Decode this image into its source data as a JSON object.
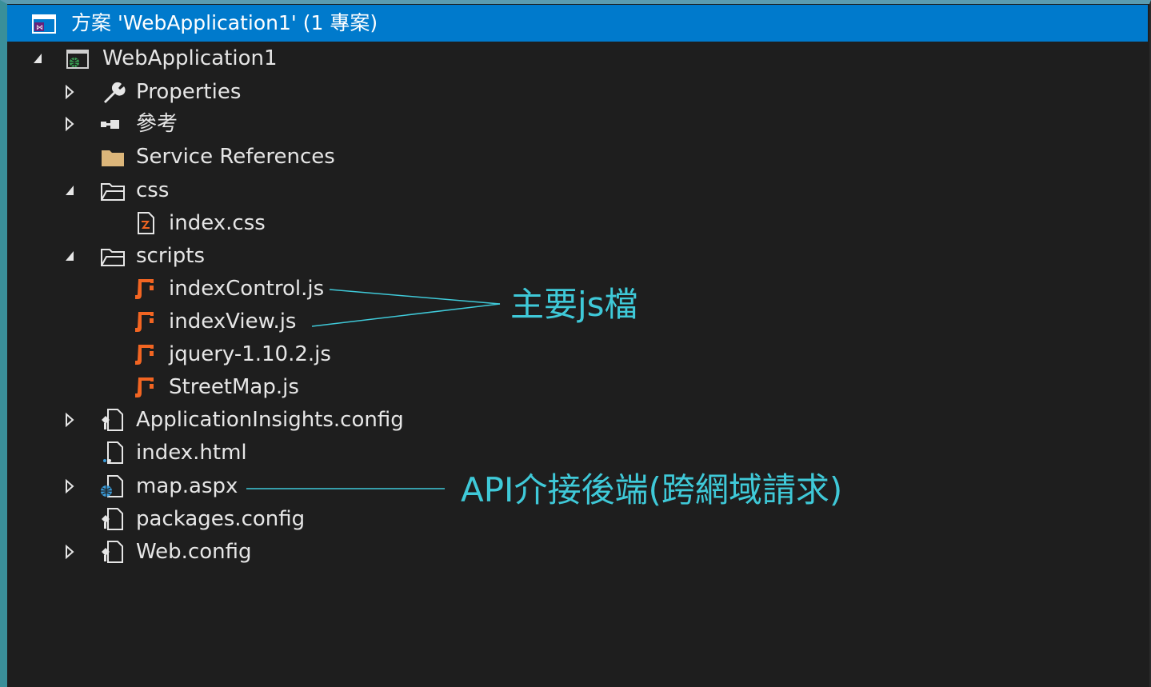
{
  "solution_explorer": {
    "title": "方案 'WebApplication1' (1 專案)",
    "items": [
      {
        "label": "WebApplication1",
        "icon": "web-project-icon",
        "expander": "expanded"
      },
      {
        "label": "Properties",
        "icon": "wrench-icon",
        "expander": "collapsed"
      },
      {
        "label": "參考",
        "icon": "references-icon",
        "expander": "collapsed"
      },
      {
        "label": "Service References",
        "icon": "folder-filled-icon",
        "expander": "none"
      },
      {
        "label": "css",
        "icon": "folder-icon",
        "expander": "expanded"
      },
      {
        "label": "index.css",
        "icon": "css-file-icon",
        "expander": "none"
      },
      {
        "label": "scripts",
        "icon": "folder-icon",
        "expander": "expanded"
      },
      {
        "label": "indexControl.js",
        "icon": "js-file-icon",
        "expander": "none"
      },
      {
        "label": "indexView.js",
        "icon": "js-file-icon",
        "expander": "none"
      },
      {
        "label": "jquery-1.10.2.js",
        "icon": "js-file-icon",
        "expander": "none"
      },
      {
        "label": "StreetMap.js",
        "icon": "js-file-icon",
        "expander": "none"
      },
      {
        "label": "ApplicationInsights.config",
        "icon": "config-file-icon",
        "expander": "collapsed"
      },
      {
        "label": "index.html",
        "icon": "html-file-icon",
        "expander": "none"
      },
      {
        "label": "map.aspx",
        "icon": "aspx-file-icon",
        "expander": "collapsed"
      },
      {
        "label": "packages.config",
        "icon": "config-file-icon",
        "expander": "none"
      },
      {
        "label": "Web.config",
        "icon": "config-file-icon",
        "expander": "collapsed"
      }
    ]
  },
  "annotations": {
    "main_js": "主要js檔",
    "api_backend": "API介接後端(跨網域請求)"
  },
  "colors": {
    "background": "#1e1e1e",
    "titlebar": "#007acc",
    "text": "#e6e6e6",
    "annotation": "#3fc9d8",
    "js_icon": "#f26522"
  }
}
